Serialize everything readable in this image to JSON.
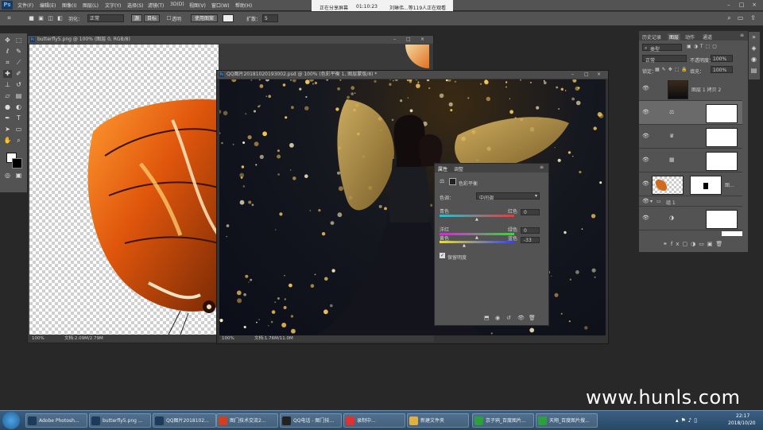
{
  "menubar": {
    "logo": "Ps",
    "items": [
      "文件(F)",
      "编辑(E)",
      "图像(I)",
      "图层(L)",
      "文字(Y)",
      "选择(S)",
      "滤镜(T)",
      "3D(D)",
      "视图(V)",
      "窗口(W)",
      "帮助(H)"
    ]
  },
  "share": {
    "label": "正在分享屏幕",
    "time": "01:10:23",
    "viewers": "刘琳伟...等119人正在观看"
  },
  "options": {
    "feather_label": "羽化：",
    "style_label": "正常",
    "subtract": "源",
    "target": "目标",
    "transparent": "透明",
    "pattern_button": "使用图案",
    "spread_label": "扩散：",
    "spread_value": "5"
  },
  "doc1": {
    "title": "butterfly5.png @ 100% (图层 0, RGB/8)",
    "zoom": "100%",
    "status": "文档:2.09M/2.79M"
  },
  "doc2": {
    "title": "QQ图片20181020193002.psd @ 100% (色彩平衡 1, 图层蒙版/8) *",
    "zoom": "100%",
    "status": "文档:1.76M/11.0M"
  },
  "properties": {
    "tab_properties": "属性",
    "tab_adjust": "调整",
    "header": "色彩平衡",
    "tone_label": "色调：",
    "tone_value": "中间调",
    "sliders": [
      {
        "left": "青色",
        "right": "红色",
        "value": "0",
        "pos": 0.5,
        "colors": [
          "#00d0e0",
          "#ff3030"
        ]
      },
      {
        "left": "洋红",
        "right": "绿色",
        "value": "0",
        "pos": 0.5,
        "colors": [
          "#e020e0",
          "#30e030"
        ]
      },
      {
        "left": "黄色",
        "right": "蓝色",
        "value": "-33",
        "pos": 0.33,
        "colors": [
          "#f0e020",
          "#3040ff"
        ]
      }
    ],
    "preserve": "保留明度"
  },
  "layers_panel": {
    "tabs": [
      "历史记录",
      "图层",
      "动作",
      "通道"
    ],
    "kind_label": "类型",
    "blend_mode": "正常",
    "opacity_label": "不透明度：",
    "opacity_value": "100%",
    "lock_label": "锁定：",
    "fill_label": "填充：",
    "fill_value": "100%",
    "layers": [
      {
        "name": "图层 1 拷贝 2",
        "thumb": "photo"
      },
      {
        "name": "",
        "thumb": "white"
      },
      {
        "name": "",
        "thumb": "white"
      },
      {
        "name": "",
        "thumb": "white"
      },
      {
        "name": "图...",
        "thumb": "mask"
      },
      {
        "name": "组 1",
        "thumb": "group"
      },
      {
        "name": "",
        "thumb": "white"
      }
    ]
  },
  "taskbar": {
    "items": [
      {
        "label": "Adobe Photosh...",
        "color": "#1b3a5c"
      },
      {
        "label": "butterfly5.png ...",
        "color": "#1b3a5c"
      },
      {
        "label": "QQ图片2018102...",
        "color": "#1b3a5c"
      },
      {
        "label": "图门技术交流2...",
        "color": "#d04020"
      },
      {
        "label": "QQ电话 - 图门技...",
        "color": "#222"
      },
      {
        "label": "录制中...",
        "color": "#e03030"
      },
      {
        "label": "新建文件夹",
        "color": "#e0b040"
      },
      {
        "label": "京子鸦_百度图片...",
        "color": "#2aa040"
      },
      {
        "label": "天翔_百度图片搜...",
        "color": "#2aa040"
      }
    ],
    "time": "22:17",
    "date": "2018/10/20"
  },
  "watermark": "www.hunls.com"
}
